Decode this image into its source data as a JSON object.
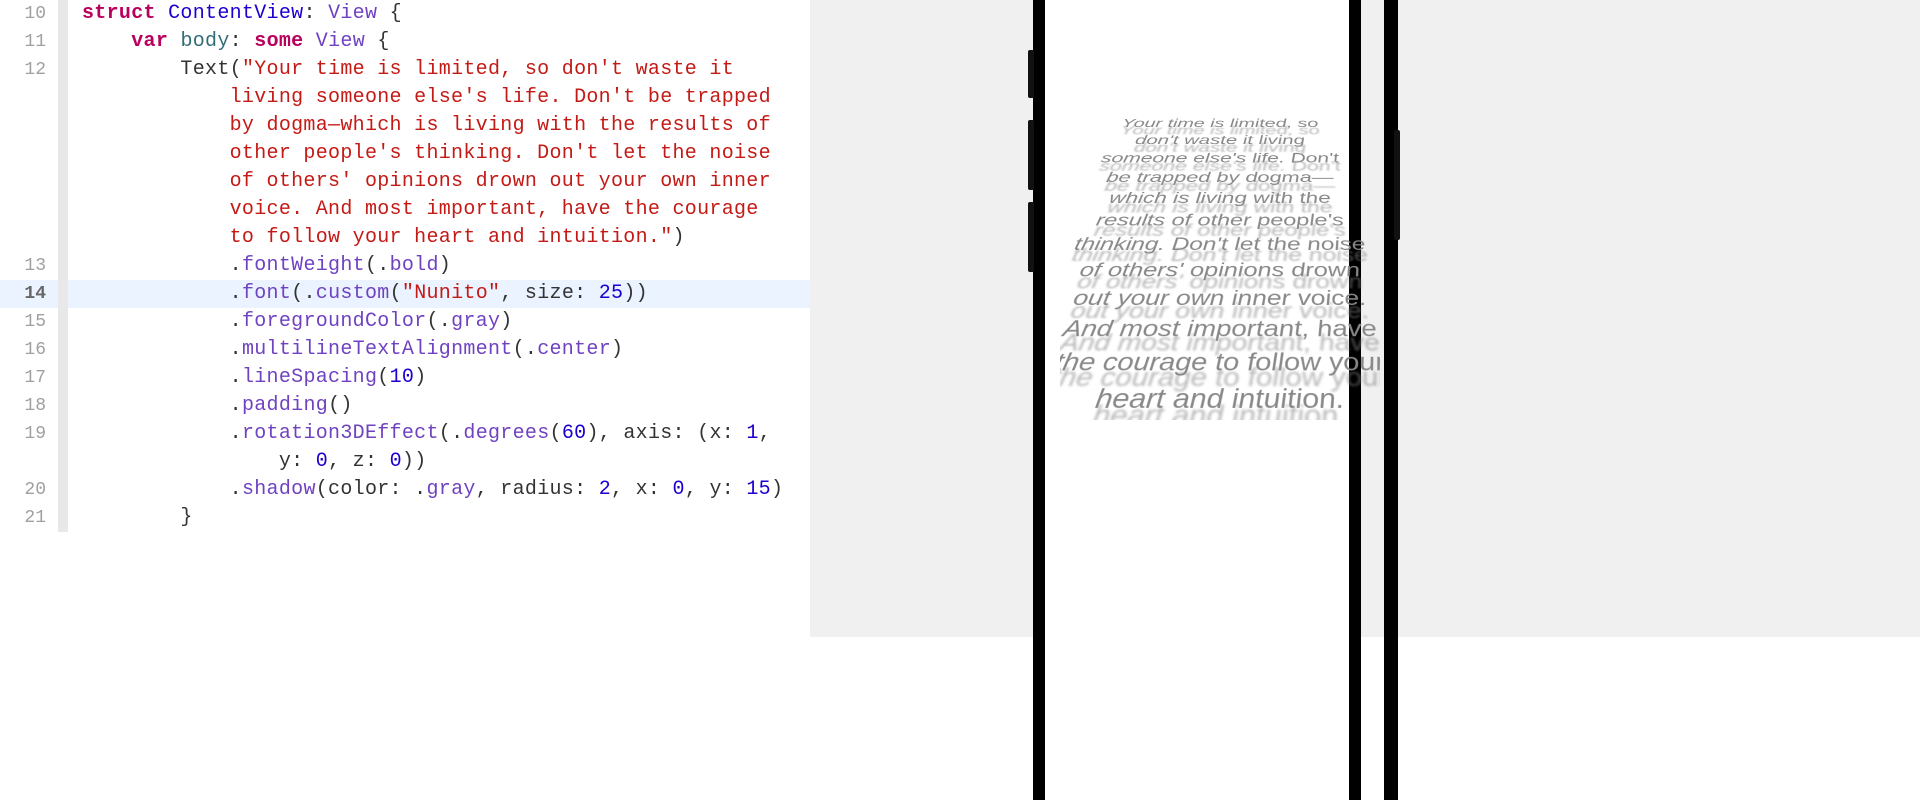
{
  "gutter": [
    "10",
    "11",
    "12",
    "",
    "",
    "",
    "",
    "",
    "",
    "",
    "13",
    "14",
    "15",
    "16",
    "17",
    "18",
    "19",
    "",
    "20",
    "21"
  ],
  "highlighted_line": 14,
  "code": {
    "l10": {
      "tok": [
        "struct",
        " ",
        "ContentView",
        ": ",
        "View",
        " {"
      ]
    },
    "l11": {
      "tok": [
        "    ",
        "var",
        " ",
        "body",
        ": ",
        "some",
        " ",
        "View",
        " {"
      ]
    },
    "l12a": {
      "tok": [
        "        Text(",
        "\"Your time is limited, so don't waste it"
      ]
    },
    "l12b": {
      "tok": [
        "            ",
        "living someone else's life. Don't be trapped"
      ]
    },
    "l12c": {
      "tok": [
        "            ",
        "by dogma—which is living with the results of"
      ]
    },
    "l12d": {
      "tok": [
        "            ",
        "other people's thinking. Don't let the noise"
      ]
    },
    "l12e": {
      "tok": [
        "            ",
        "of others' opinions drown out your own inner"
      ]
    },
    "l12f": {
      "tok": [
        "            ",
        "voice. And most important, have the courage"
      ]
    },
    "l12g": {
      "tok": [
        "            ",
        "to follow your heart and intuition.\"",
        ")"
      ]
    },
    "l13": {
      "tok": [
        "            .",
        "fontWeight",
        "(.",
        "bold",
        ")"
      ]
    },
    "l14": {
      "tok": [
        "            .",
        "font",
        "(.",
        "custom",
        "(",
        "\"Nunito\"",
        ", size: ",
        "25",
        "))"
      ]
    },
    "l15": {
      "tok": [
        "            .",
        "foregroundColor",
        "(.",
        "gray",
        ")"
      ]
    },
    "l16": {
      "tok": [
        "            .",
        "multilineTextAlignment",
        "(.",
        "center",
        ")"
      ]
    },
    "l17": {
      "tok": [
        "            .",
        "lineSpacing",
        "(",
        "10",
        ")"
      ]
    },
    "l18": {
      "tok": [
        "            .",
        "padding",
        "()"
      ]
    },
    "l19a": {
      "tok": [
        "            .",
        "rotation3DEffect",
        "(.",
        "degrees",
        "(",
        "60",
        "), axis: (x: ",
        "1",
        ","
      ]
    },
    "l19b": {
      "tok": [
        "                ",
        "y: ",
        "0",
        ", z: ",
        "0",
        "))"
      ]
    },
    "l20": {
      "tok": [
        "            .",
        "shadow",
        "(color: .",
        "gray",
        ", radius: ",
        "2",
        ", x: ",
        "0",
        ", y: ",
        "15",
        ")"
      ]
    },
    "l21": {
      "tok": [
        "        }"
      ]
    }
  },
  "preview_text": "Your time is limited, so don't waste it living someone else's life. Don't be trapped by dogma—which is living with the results of other people's thinking. Don't let the noise of others' opinions drown out your own inner voice. And most important, have the courage to follow your heart and intuition."
}
